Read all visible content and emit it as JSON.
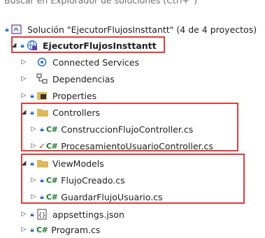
{
  "search": {
    "placeholder": "Buscar en Explorador de soluciones (Ctrl+`)"
  },
  "solution": {
    "label": "Solución \"EjecutorFlujosInsttantt\" (4 de 4 proyectos)"
  },
  "project": {
    "label": "EjecutorFlujosInsttantt"
  },
  "items": {
    "connected_services": "Connected Services",
    "dependencies": "Dependencias",
    "properties": "Properties",
    "controllers": "Controllers",
    "construccion": "ConstruccionFlujoController.cs",
    "procesamiento": "ProcesamientoUsuarioController.cs",
    "viewmodels": "ViewModels",
    "flujo_creado": "FlujoCreado.cs",
    "guardar_flujo": "GuardarFlujoUsuario.cs",
    "appsettings": "appsettings.json",
    "program": "Program.cs"
  },
  "cs_badge": "C#",
  "colors": {
    "highlight": "#e23b3b",
    "folder": "#dcb85a",
    "csharp": "#1e7b34",
    "lock": "#1f6bd1"
  }
}
